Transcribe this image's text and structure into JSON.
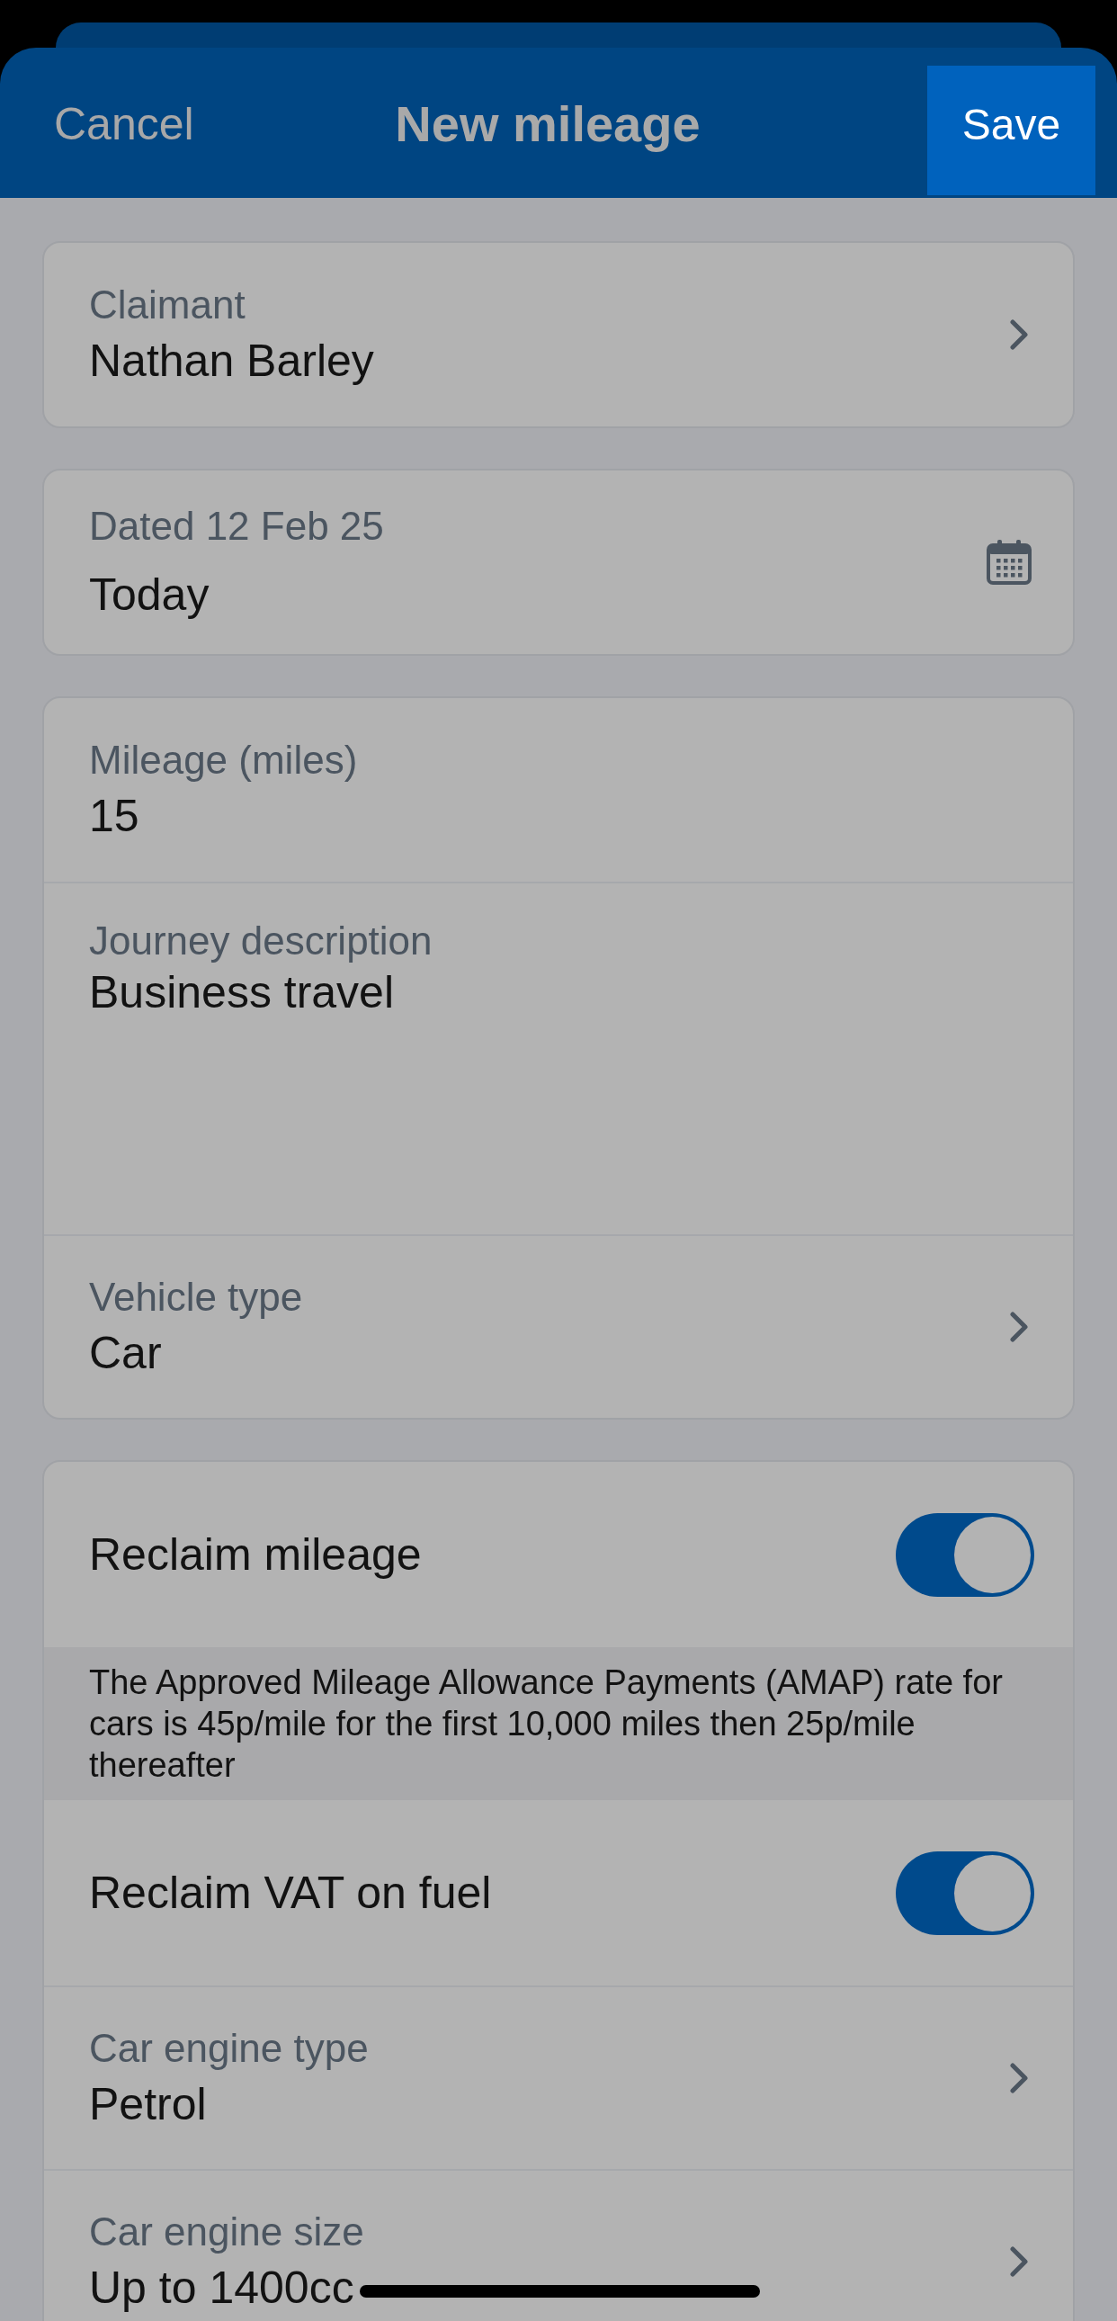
{
  "header": {
    "cancel": "Cancel",
    "title": "New mileage",
    "save": "Save"
  },
  "sections": [
    {
      "rows": [
        {
          "kind": "picker",
          "label": "Claimant",
          "value": "Nathan Barley"
        }
      ]
    },
    {
      "rows": [
        {
          "kind": "date",
          "label": "Dated 12 Feb 25",
          "value": "Today"
        }
      ]
    },
    {
      "rows": [
        {
          "kind": "field",
          "label": "Mileage (miles)",
          "value": "15"
        },
        {
          "kind": "textarea",
          "label": "Journey description",
          "value": "Business travel"
        },
        {
          "kind": "picker",
          "label": "Vehicle type",
          "value": "Car"
        }
      ]
    },
    {
      "rows": [
        {
          "kind": "toggle",
          "label": "Reclaim mileage",
          "on": true
        },
        {
          "kind": "note",
          "text": "The Approved Mileage Allowance Payments (AMAP) rate for cars is 45p/mile for the first 10,000 miles then 25p/mile thereafter"
        },
        {
          "kind": "toggle",
          "label": "Reclaim VAT on fuel",
          "on": true
        },
        {
          "kind": "picker",
          "label": "Car engine type",
          "value": "Petrol"
        },
        {
          "kind": "picker",
          "label": "Car engine size",
          "value": "Up to 1400cc"
        }
      ]
    }
  ]
}
